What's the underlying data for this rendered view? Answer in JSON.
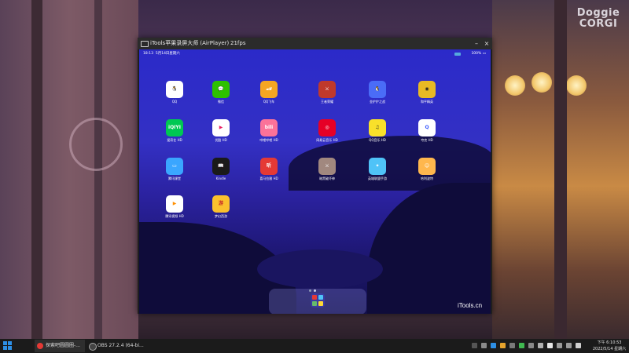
{
  "desktop": {
    "watermark_line1": "Doggie",
    "watermark_line2": "CORGI"
  },
  "window": {
    "title": "iTools苹果录屏大师 (AirPlayer)",
    "fps": "21fps",
    "minimize": "–",
    "close": "×"
  },
  "ipad": {
    "status_time": "18:13",
    "status_date": "5月14日星期六",
    "battery": "100%",
    "apps": [
      {
        "label": "QQ",
        "color": "#ffffff",
        "glyph": "🐧",
        "fg": "#000"
      },
      {
        "label": "微信",
        "color": "#2dc100",
        "glyph": "💬",
        "fg": "#fff"
      },
      {
        "label": "QQ飞车",
        "color": "#f5a623",
        "glyph": "🏎",
        "fg": "#fff"
      },
      {
        "label": "王者荣耀",
        "color": "#c0392b",
        "glyph": "⚔",
        "fg": "#fff"
      },
      {
        "label": "金铲铲之战",
        "color": "#4a6cf7",
        "glyph": "🐧",
        "fg": "#fff"
      },
      {
        "label": "和平精英",
        "color": "#e8b923",
        "glyph": "◉",
        "fg": "#222"
      },
      {
        "label": "爱奇艺 HD",
        "color": "#00c853",
        "glyph": "iQIYI",
        "fg": "#fff"
      },
      {
        "label": "优酷 HD",
        "color": "#ffffff",
        "glyph": "▶",
        "fg": "#e91e63"
      },
      {
        "label": "哔哩哔哩 HD",
        "color": "#fb7299",
        "glyph": "bili",
        "fg": "#fff"
      },
      {
        "label": "网易云音乐 HD",
        "color": "#e60026",
        "glyph": "◎",
        "fg": "#fff"
      },
      {
        "label": "QQ音乐 HD",
        "color": "#f9e02a",
        "glyph": "♫",
        "fg": "#222"
      },
      {
        "label": "夸克 HD",
        "color": "#ffffff",
        "glyph": "Q",
        "fg": "#3b5bfd"
      },
      {
        "label": "腾讯课堂",
        "color": "#3aa6ff",
        "glyph": "▭",
        "fg": "#fff"
      },
      {
        "label": "Kindle",
        "color": "#1a1a1a",
        "glyph": "📖",
        "fg": "#fff"
      },
      {
        "label": "喜马拉雅 HD",
        "color": "#e53935",
        "glyph": "听",
        "fg": "#fff"
      },
      {
        "label": "暗黑破坏神",
        "color": "#a1887f",
        "glyph": "⚔",
        "fg": "#fff"
      },
      {
        "label": "英雄联盟手游",
        "color": "#4fc3f7",
        "glyph": "✦",
        "fg": "#fff"
      },
      {
        "label": "哈利波特",
        "color": "#ffb74d",
        "glyph": "☺",
        "fg": "#fff"
      },
      {
        "label": "腾讯视频 HD",
        "color": "#ffffff",
        "glyph": "▶",
        "fg": "#ff8f00"
      },
      {
        "label": "梦幻西游",
        "color": "#fbc02d",
        "glyph": "游",
        "fg": "#c62828"
      }
    ],
    "brand": "iTools.cn"
  },
  "taskbar": {
    "app1": "探索吧圆圆圈-...",
    "app2": "OBS 27.2.4 (64-bi...",
    "time": "下午 6:10:53",
    "date": "2022/5/14 星期六"
  }
}
